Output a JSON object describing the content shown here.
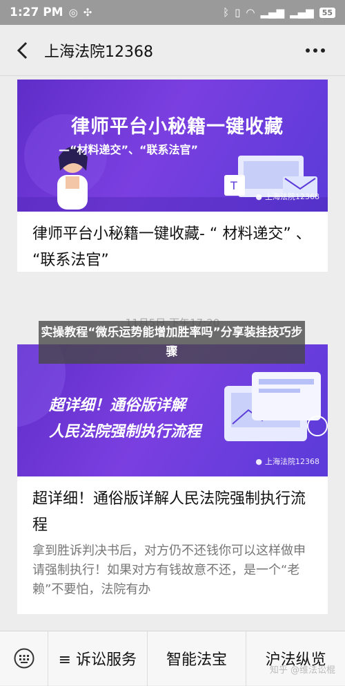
{
  "status_bar": {
    "time": "1:27 PM",
    "battery": "55"
  },
  "header": {
    "title": "上海法院12368"
  },
  "articles": [
    {
      "cover_title": "律师平台小秘籍一键收藏",
      "cover_subtitle": "—“材料递交”、“联系法官”",
      "cover_brand": "上海法院12368",
      "title": "律师平台小秘籍一键收藏- “ 材料递交” 、 “联系法官”"
    },
    {
      "cover_title_line1": "超详细！通俗版详解",
      "cover_title_line2": "人民法院强制执行流程",
      "cover_brand": "上海法院12368",
      "title": "超详细！通俗版详解人民法院强制执行流程",
      "description": "拿到胜诉判决书后，对方仍不还钱你可以这样做申请强制执行！如果对方有钱故意不还，是一个“老赖”不要怕，法院有办"
    }
  ],
  "timestamp": "11月5日 下午17:20",
  "overlay_caption": "实操教程“微乐运势能增加胜率吗”分享装挂技巧步骤",
  "bottom_menu": {
    "items": [
      "≡ 诉讼服务",
      "智能法宝",
      "沪法纵览"
    ]
  },
  "watermark": "知乎 @维法讼棍",
  "colors": {
    "cover_purple": "#6a35d6",
    "background": "#ededed"
  }
}
